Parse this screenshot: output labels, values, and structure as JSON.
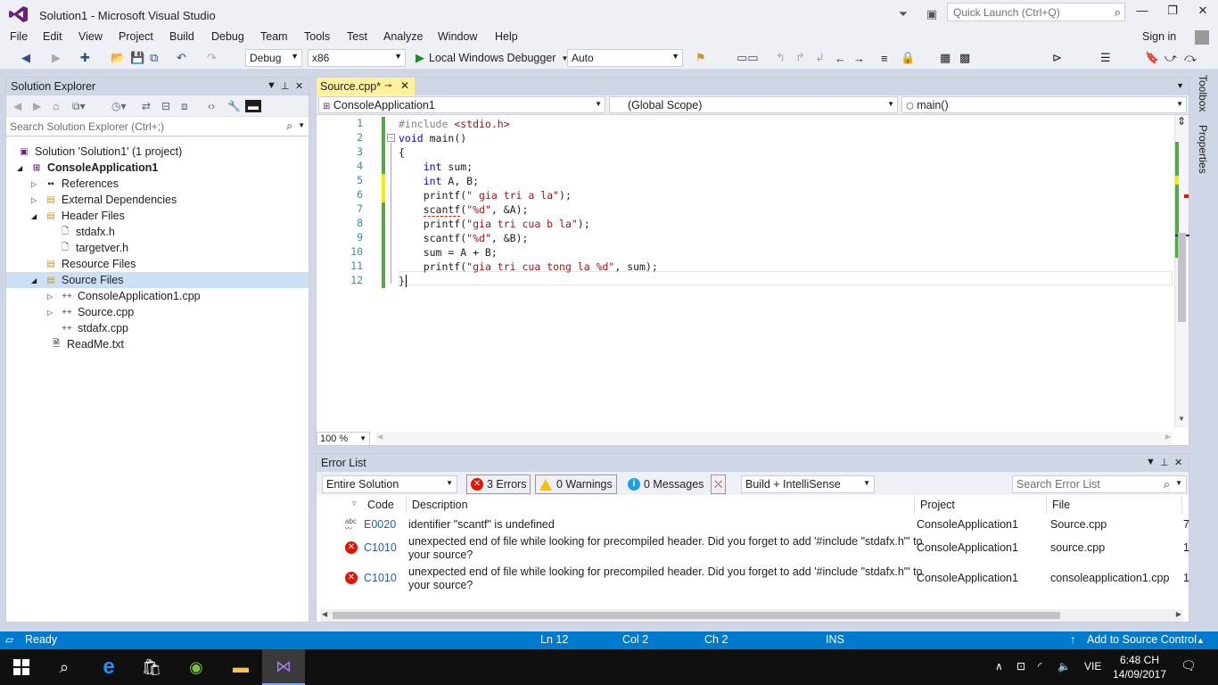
{
  "window": {
    "title": "Solution1 - Microsoft Visual Studio"
  },
  "quick_launch": {
    "placeholder": "Quick Launch (Ctrl+Q)"
  },
  "menu": {
    "items": [
      "File",
      "Edit",
      "View",
      "Project",
      "Build",
      "Debug",
      "Team",
      "Tools",
      "Test",
      "Analyze",
      "Window",
      "Help"
    ],
    "sign_in": "Sign in"
  },
  "toolbar": {
    "config": "Debug",
    "platform": "x86",
    "debugger": "Local Windows Debugger",
    "solution_config": "Auto"
  },
  "solution_explorer": {
    "title": "Solution Explorer",
    "search_placeholder": "Search Solution Explorer (Ctrl+;)",
    "nodes": [
      {
        "label": "Solution 'Solution1' (1 project)",
        "icon": "solution-icon"
      },
      {
        "label": "ConsoleApplication1",
        "icon": "project-icon",
        "bold": true
      },
      {
        "label": "References",
        "icon": "references-icon"
      },
      {
        "label": "External Dependencies",
        "icon": "folder-icon"
      },
      {
        "label": "Header Files",
        "icon": "folder-icon"
      },
      {
        "label": "stdafx.h",
        "icon": "header-file-icon"
      },
      {
        "label": "targetver.h",
        "icon": "header-file-icon"
      },
      {
        "label": "Resource Files",
        "icon": "folder-icon"
      },
      {
        "label": "Source Files",
        "icon": "folder-icon",
        "selected": true
      },
      {
        "label": "ConsoleApplication1.cpp",
        "icon": "cpp-file-icon"
      },
      {
        "label": "Source.cpp",
        "icon": "cpp-file-icon"
      },
      {
        "label": "stdafx.cpp",
        "icon": "cpp-file-icon"
      },
      {
        "label": "ReadMe.txt",
        "icon": "text-file-icon"
      }
    ]
  },
  "editor": {
    "tab_label": "Source.cpp*",
    "nav_project": "ConsoleApplication1",
    "nav_scope": "(Global Scope)",
    "nav_member": "main()",
    "zoom": "100 %",
    "line_numbers": [
      "1",
      "2",
      "3",
      "4",
      "5",
      "6",
      "7",
      "8",
      "9",
      "10",
      "11",
      "12"
    ],
    "lines": [
      [
        {
          "t": "#include ",
          "c": "pp"
        },
        {
          "t": "<stdio.h>",
          "c": "st"
        }
      ],
      [
        {
          "t": "void",
          "c": "kw"
        },
        {
          "t": " main()",
          "c": "pl"
        }
      ],
      [
        {
          "t": "{",
          "c": "pl"
        }
      ],
      [
        {
          "t": "    ",
          "c": "pl"
        },
        {
          "t": "int",
          "c": "kw"
        },
        {
          "t": " sum;",
          "c": "pl"
        }
      ],
      [
        {
          "t": "    ",
          "c": "pl"
        },
        {
          "t": "int",
          "c": "kw"
        },
        {
          "t": " A, B;",
          "c": "pl"
        }
      ],
      [
        {
          "t": "    printf(",
          "c": "pl"
        },
        {
          "t": "\" gia tri a la\"",
          "c": "st"
        },
        {
          "t": ");",
          "c": "pl"
        }
      ],
      [
        {
          "t": "    ",
          "c": "pl"
        },
        {
          "t": "scantf",
          "c": "pl squig"
        },
        {
          "t": "(",
          "c": "pl"
        },
        {
          "t": "\"%d\"",
          "c": "st"
        },
        {
          "t": ", &A);",
          "c": "pl"
        }
      ],
      [
        {
          "t": "    printf(",
          "c": "pl"
        },
        {
          "t": "\"gia tri cua b la\"",
          "c": "st"
        },
        {
          "t": ");",
          "c": "pl"
        }
      ],
      [
        {
          "t": "    scantf(",
          "c": "pl"
        },
        {
          "t": "\"%d\"",
          "c": "st"
        },
        {
          "t": ", &B);",
          "c": "pl"
        }
      ],
      [
        {
          "t": "    sum = A + B;",
          "c": "pl"
        }
      ],
      [
        {
          "t": "    printf(",
          "c": "pl"
        },
        {
          "t": "\"gia tri cua tong la %d\"",
          "c": "st"
        },
        {
          "t": ", sum);",
          "c": "pl"
        }
      ],
      [
        {
          "t": "}",
          "c": "pl"
        }
      ]
    ]
  },
  "right_rail": {
    "toolbox": "Toolbox",
    "properties": "Properties"
  },
  "error_list": {
    "title": "Error List",
    "scope": "Entire Solution",
    "errors_label": "3 Errors",
    "warnings_label": "0 Warnings",
    "messages_label": "0 Messages",
    "source": "Build + IntelliSense",
    "search_placeholder": "Search Error List",
    "columns": {
      "code": "Code",
      "description": "Description",
      "project": "Project",
      "file": "File"
    },
    "rows": [
      {
        "icon": "intellisense-error-icon",
        "code": "E0020",
        "description_1": "identifier \"scantf\" is undefined",
        "description_2": "",
        "project": "ConsoleApplication1",
        "file": "Source.cpp",
        "line": "7"
      },
      {
        "icon": "error-icon",
        "code": "C1010",
        "description_1": "unexpected end of file while looking for precompiled header. Did you forget to add '#include \"stdafx.h\"' to",
        "description_2": "your source?",
        "project": "ConsoleApplication1",
        "file": "source.cpp",
        "line": "1"
      },
      {
        "icon": "error-icon",
        "code": "C1010",
        "description_1": "unexpected end of file while looking for precompiled header. Did you forget to add '#include \"stdafx.h\"' to",
        "description_2": "your source?",
        "project": "ConsoleApplication1",
        "file": "consoleapplication1.cpp",
        "line": "1"
      }
    ]
  },
  "status_bar": {
    "state": "Ready",
    "line": "Ln 12",
    "col": "Col 2",
    "ch": "Ch 2",
    "mode": "INS",
    "source_control": "Add to Source Control"
  },
  "taskbar": {
    "language": "VIE",
    "time": "6:48 CH",
    "date": "14/09/2017"
  },
  "colors": {
    "accent": "#007acc",
    "chrome": "#eef0f5",
    "panel_header": "#cfd6e5",
    "tab_active": "#fff29d",
    "error": "#e51400"
  }
}
